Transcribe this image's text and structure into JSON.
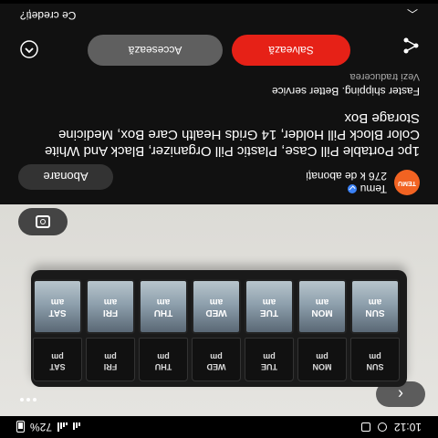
{
  "status": {
    "time": "10:12",
    "battery": "72%"
  },
  "pillbox": {
    "top_labels": [
      [
        "SUN",
        "am"
      ],
      [
        "MON",
        "am"
      ],
      [
        "TUE",
        "am"
      ],
      [
        "WED",
        "am"
      ],
      [
        "THU",
        "am"
      ],
      [
        "FRI",
        "am"
      ],
      [
        "SAT",
        "am"
      ]
    ],
    "bottom_labels": [
      [
        "SUN",
        "pm"
      ],
      [
        "MON",
        "pm"
      ],
      [
        "TUE",
        "pm"
      ],
      [
        "WED",
        "pm"
      ],
      [
        "THU",
        "pm"
      ],
      [
        "FRI",
        "pm"
      ],
      [
        "SAT",
        "pm"
      ]
    ]
  },
  "channel": {
    "name": "Temu",
    "subscribers": "276 k de abonați",
    "logo_text": "TEMU",
    "subscribe_label": "Abonare"
  },
  "product": {
    "title": "1pc Portable Pill Case, Plastic Pill Organizer, Black And White Color Block Pill Holder, 14 Grids Health Care Box, Medicine Storage Box",
    "subtitle": "Faster shipping. Better service",
    "translate": "Vezi traducerea"
  },
  "actions": {
    "save_label": "Salvează",
    "visit_label": "Accesează"
  },
  "comments": {
    "label": "Ce credeți?"
  },
  "colors": {
    "save": "#e62117",
    "temu": "#f26322"
  }
}
